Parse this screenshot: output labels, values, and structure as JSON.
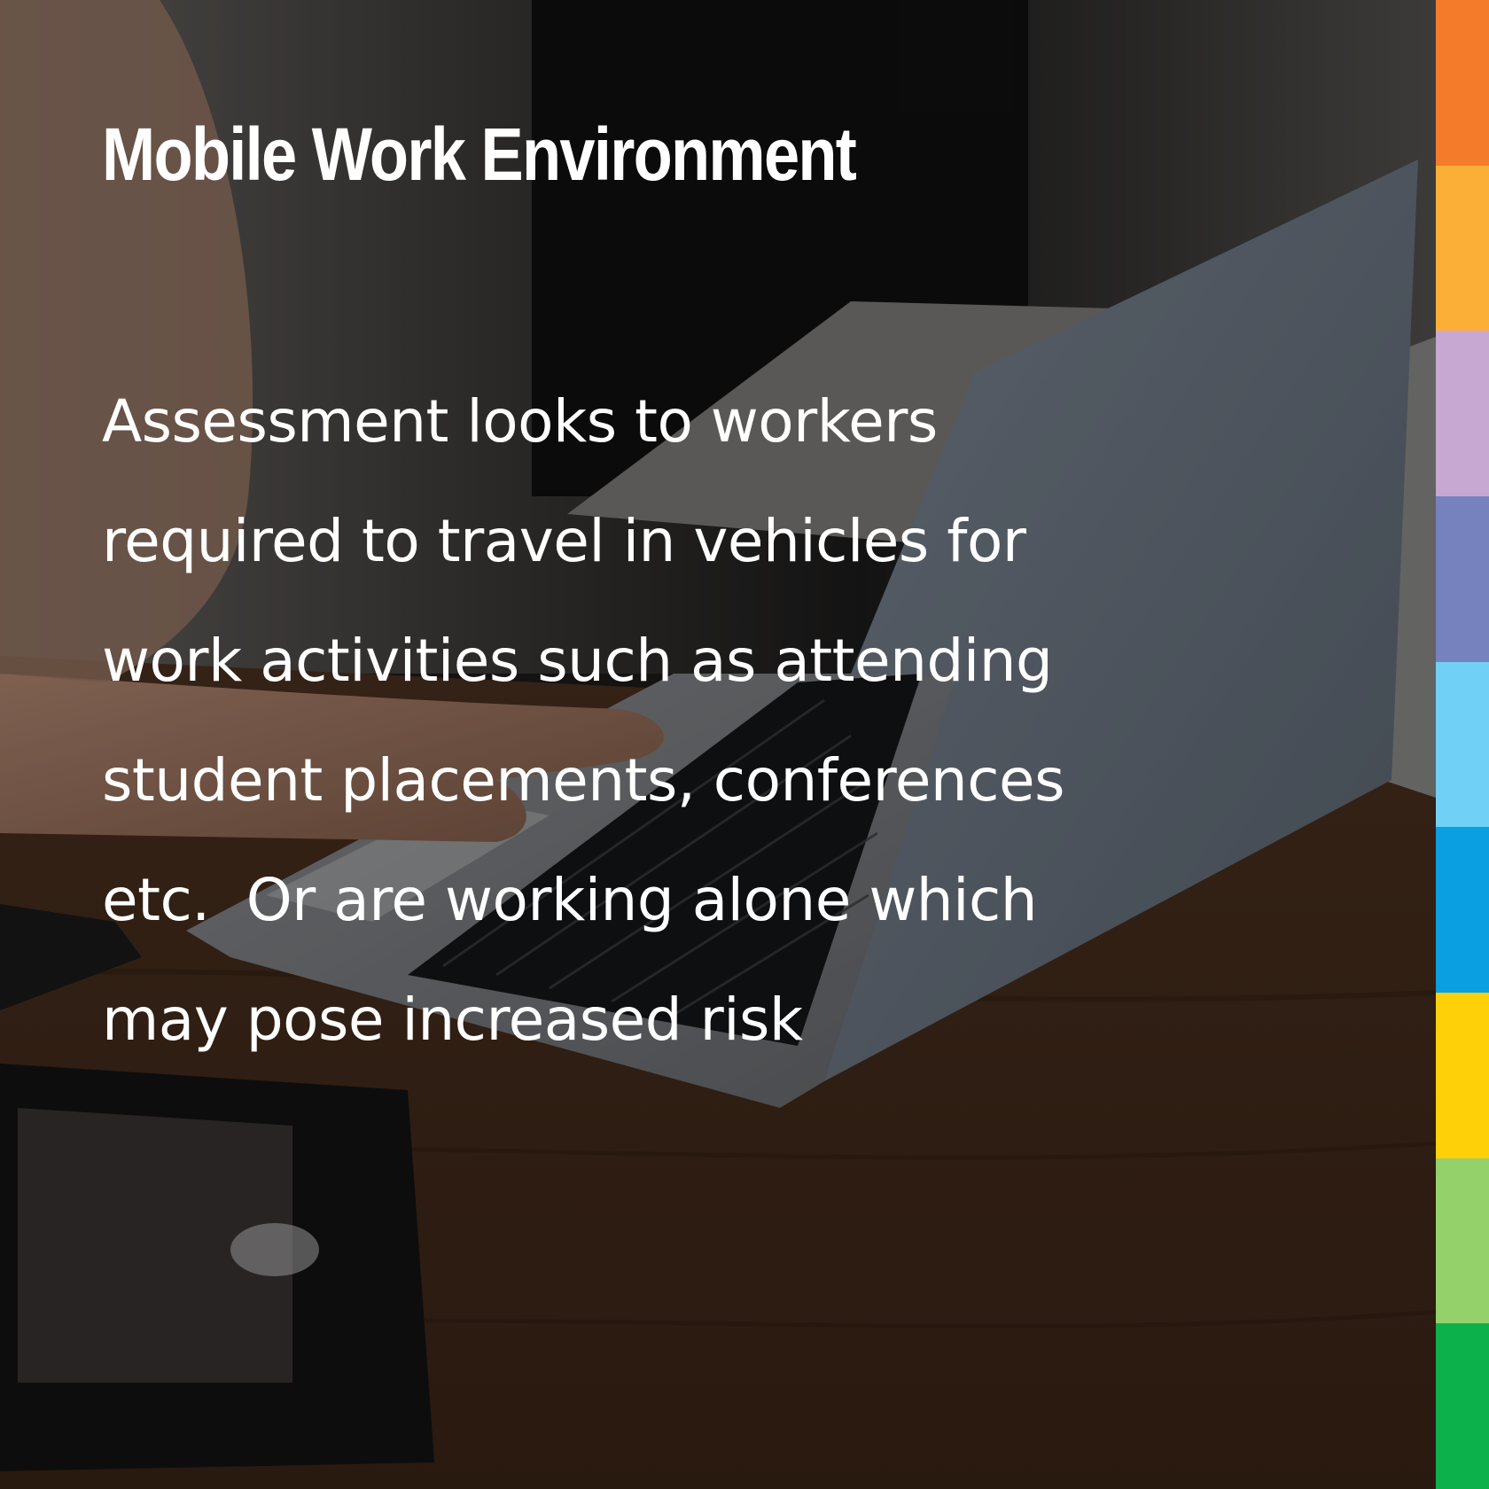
{
  "title": "Mobile Work Environment",
  "body_lines": [
    "Assessment looks to workers",
    "required to travel in vehicles for",
    "work activities such as attending",
    "student placements, conferences",
    "etc.  Or are working alone which",
    "may pose increased risk"
  ],
  "photo_description_icon": "laptop-photo",
  "accent_stripes": [
    {
      "color": "#F47B2A"
    },
    {
      "color": "#FBAF36"
    },
    {
      "color": "#C6A8D3"
    },
    {
      "color": "#7582BE"
    },
    {
      "color": "#71D0F6"
    },
    {
      "color": "#0A9FE0"
    },
    {
      "color": "#FDD007"
    },
    {
      "color": "#95D16A"
    },
    {
      "color": "#0DB14B"
    }
  ]
}
